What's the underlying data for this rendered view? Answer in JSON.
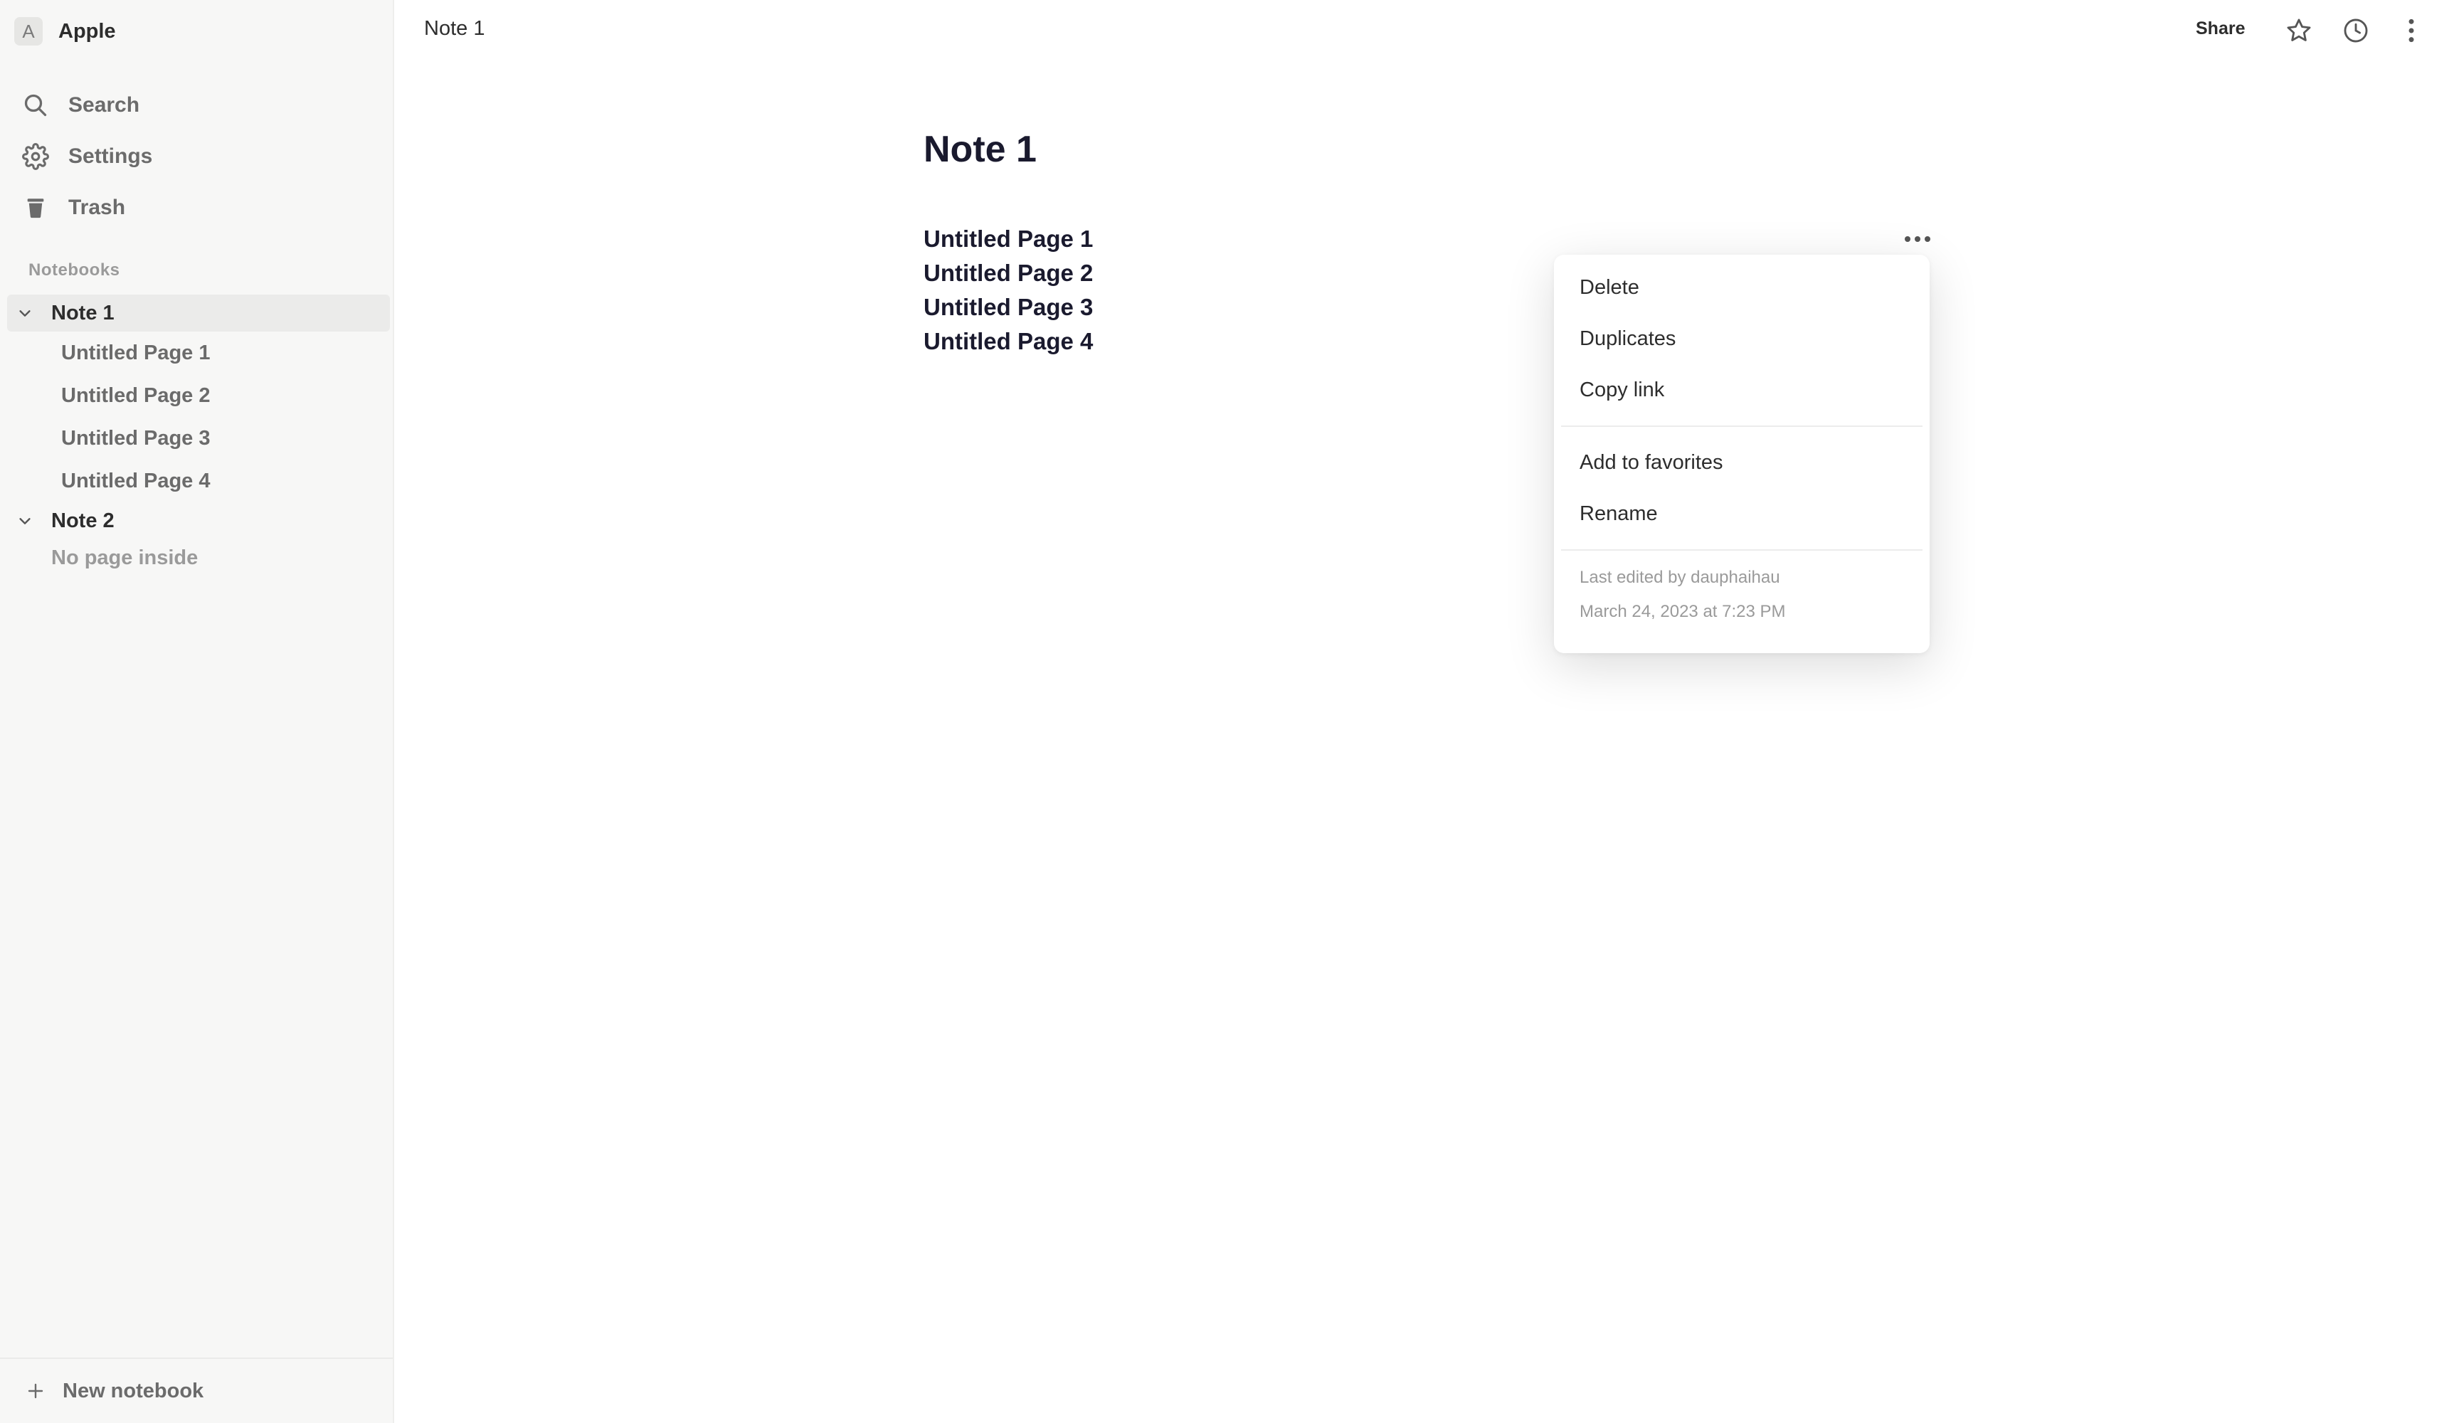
{
  "workspace": {
    "initial": "A",
    "name": "Apple"
  },
  "nav": [
    {
      "label": "Search",
      "icon": "search-icon"
    },
    {
      "label": "Settings",
      "icon": "gear-icon"
    },
    {
      "label": "Trash",
      "icon": "trash-icon"
    }
  ],
  "sidebar": {
    "section_label": "Notebooks",
    "notebooks": [
      {
        "label": "Note 1",
        "expanded": true,
        "active": true,
        "pages": [
          "Untitled Page 1",
          "Untitled Page 2",
          "Untitled Page 3",
          "Untitled Page 4"
        ]
      },
      {
        "label": "Note 2",
        "expanded": true,
        "active": false,
        "empty_text": "No page inside"
      }
    ],
    "new_notebook_label": "New notebook"
  },
  "topbar": {
    "breadcrumb": "Note 1",
    "share_label": "Share",
    "icons": [
      "star-icon",
      "clock-icon",
      "more-vertical-icon"
    ]
  },
  "document": {
    "title": "Note 1",
    "pages": [
      "Untitled Page 1",
      "Untitled Page 2",
      "Untitled Page 3",
      "Untitled Page 4"
    ]
  },
  "context_menu": {
    "group1": [
      "Delete",
      "Duplicates",
      "Copy link"
    ],
    "group2": [
      "Add to favorites",
      "Rename"
    ],
    "last_edited": "Last edited by dauphaihau",
    "timestamp": "March 24, 2023 at 7:23 PM"
  },
  "colors": {
    "sidebar_bg": "#f7f7f6",
    "active_row": "#ebebea",
    "text_dark": "#1a1a2e",
    "text_muted": "#6b6b6b"
  }
}
